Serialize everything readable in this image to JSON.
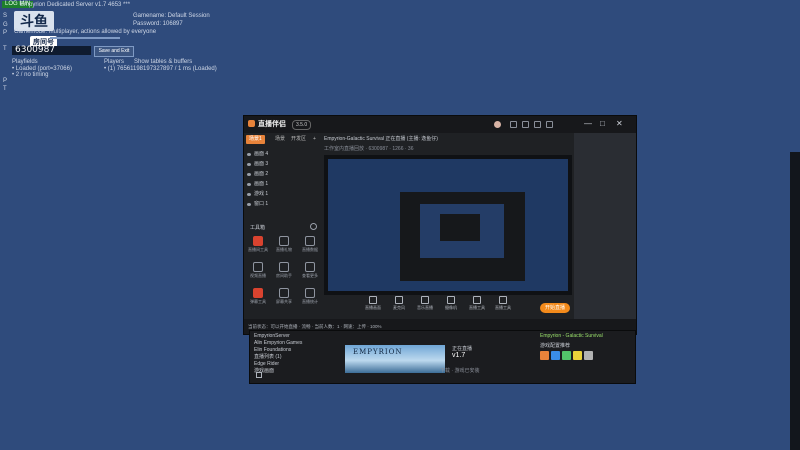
{
  "server": {
    "status": "LOG MIN",
    "title": "Empyrion Dedicated Server v1.7 4653 ***",
    "logo_text": "斗鱼",
    "badge": "房间号",
    "room_number": "6300987",
    "start_button": "Save and Exit",
    "gamename": "Gamename: Default Session",
    "password": "Password: 106897",
    "mode_line": "Gamemode: multiplayer, actions allowed by everyone",
    "playfields_label": "Playfields",
    "players_label": "Players",
    "show_tables": "Show tables & buffers",
    "playfield_entry_1": "• Loaded (port=37066)",
    "playfield_entry_2": "• 2 / no timing",
    "player_entry": "• (1) 76561198197327897 / 1 ms (Loaded)",
    "side_letters": [
      "S",
      "G",
      "P",
      "T",
      "P",
      "T"
    ]
  },
  "app": {
    "name": "直播伴侣",
    "version": "3.5.0",
    "user_tag": "主播",
    "window_buttons": [
      "—",
      "□",
      "✕"
    ],
    "tabs": [
      "场景1",
      "场景",
      "开发区",
      "+"
    ],
    "scenes": [
      "画面 4",
      "画面 3",
      "画面 2",
      "画面 1",
      "游戏 1",
      "窗口 1"
    ],
    "add_label": "工具箱",
    "tools": [
      {
        "label": "直播间工具",
        "hot": true
      },
      {
        "label": "直播礼物",
        "hot": false
      },
      {
        "label": "直播数据",
        "hot": false
      },
      {
        "label": "视频直播",
        "hot": false
      },
      {
        "label": "房间助手",
        "hot": false
      },
      {
        "label": "查看更多",
        "hot": false
      },
      {
        "label": "弹幕工具",
        "hot": false
      },
      {
        "label": "屏幕共享",
        "hot": false
      },
      {
        "label": "直播统计",
        "hot": false
      }
    ],
    "preview_title": "Empyrion-Galactic Survival 正在直播 (主播: 逸鱼仔)",
    "preview_sub": "工作室内直播回放 · 6300987 · 1266 · 36",
    "bottom_items": [
      "直播画面",
      "麦克风",
      "音乐直播",
      "摄像机",
      "直播工具",
      "直播工具"
    ],
    "go_live": "开始直播",
    "statusbar": "当前状态：可以开始直播 · 流畅 · 当前人数：1 · 网速：上传 · 100%"
  },
  "lower": {
    "list": [
      "EmpyrionServer",
      "Alin Empyrion Games",
      "Elin Foundations",
      "直播列表 (1)",
      "Edge Rider",
      "游戏画面"
    ],
    "banner_text": "EMPYRION",
    "meta": "正在直播",
    "version": "v1.7",
    "page_hint": "下载 · 游戏已安装",
    "streamer": "Empyrion - Galactic Survival",
    "tile_label": "游戏配置推荐",
    "tiles": [
      "#e8833a",
      "#3a8de8",
      "#52c46a",
      "#e8d23a",
      "#b2b2b2"
    ]
  }
}
